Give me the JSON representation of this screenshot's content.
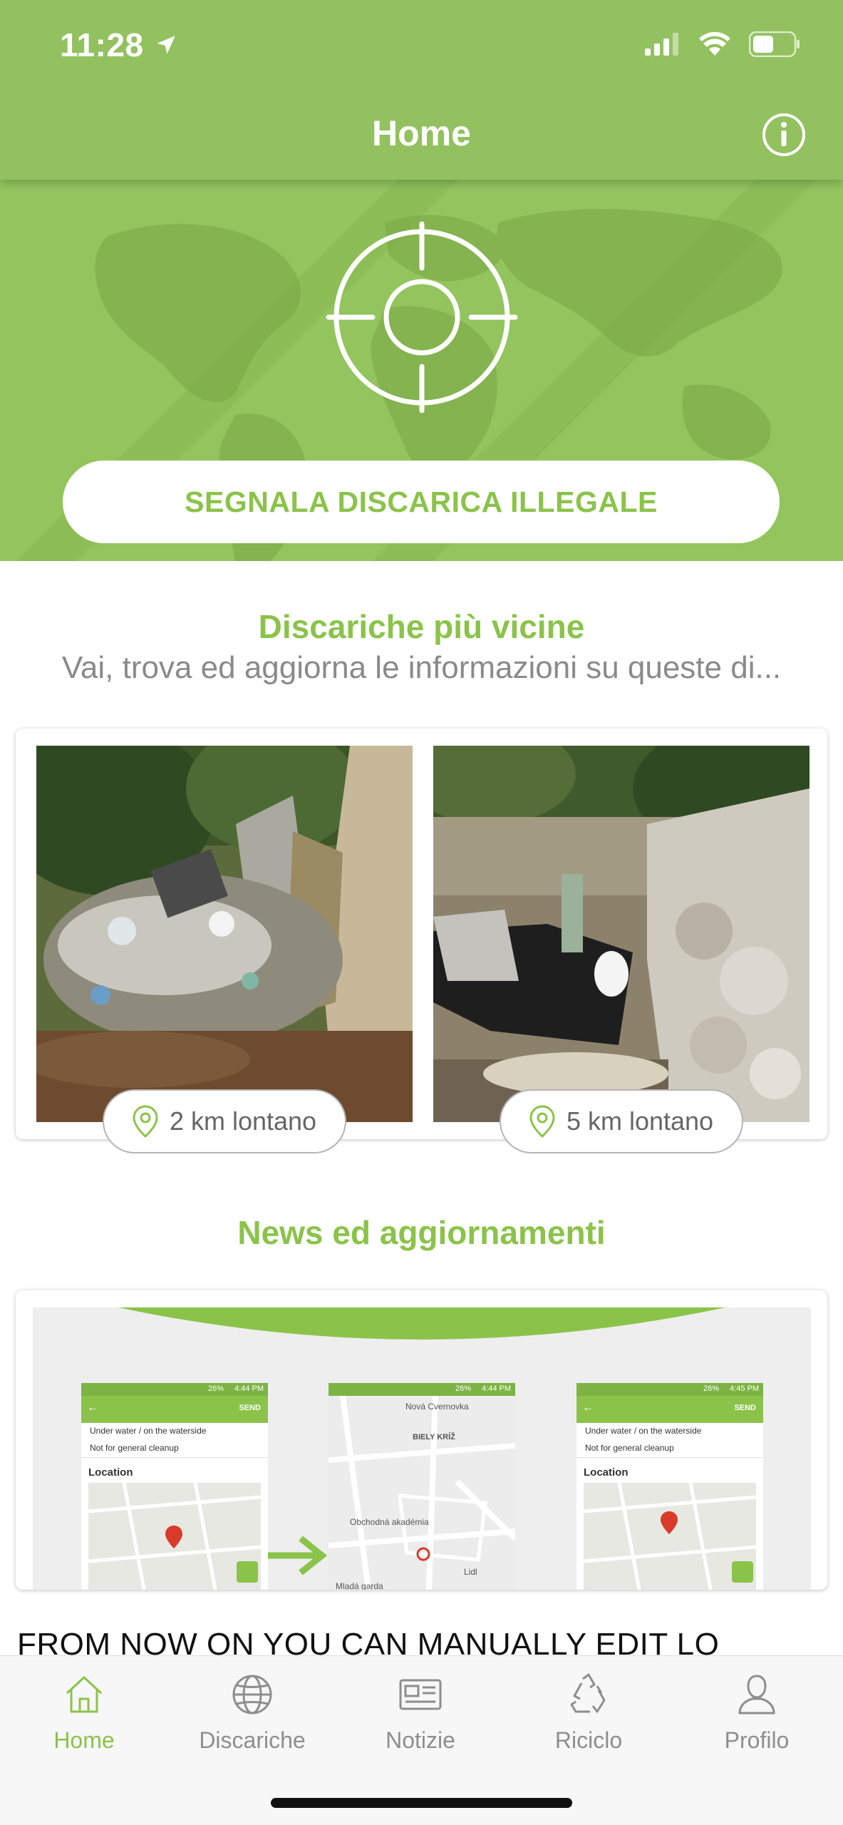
{
  "status_bar": {
    "time": "11:28"
  },
  "header": {
    "title": "Home"
  },
  "hero": {
    "report_button": "SEGNALA DISCARICA ILLEGALE"
  },
  "nearby": {
    "title": "Discariche più vicine",
    "subtitle": "Vai, trova ed aggiorna le informazioni su queste di...",
    "items": [
      {
        "distance": "2 km lontano"
      },
      {
        "distance": "5 km lontano"
      }
    ]
  },
  "news": {
    "title": "News ed aggiornamenti",
    "headline": "FROM NOW ON YOU CAN MANUALLY EDIT LO",
    "screens": [
      {
        "time": "4:44 PM",
        "battery": "26%",
        "action": "SEND",
        "row1": "Under water / on the waterside",
        "row2": "Not for general cleanup",
        "section": "Location"
      },
      {
        "time": "4:44 PM",
        "battery": "26%",
        "places": [
          "Nová Cvernovka",
          "BIELY KRÍŽ",
          "Obchodná akadémia",
          "Mladá garda",
          "Lidl"
        ]
      },
      {
        "time": "4:45 PM",
        "battery": "26%",
        "action": "SEND",
        "row1": "Under water / on the waterside",
        "row2": "Not for general cleanup",
        "section": "Location"
      }
    ]
  },
  "tabs": [
    {
      "label": "Home",
      "icon": "home-icon",
      "active": true
    },
    {
      "label": "Discariche",
      "icon": "globe-icon",
      "active": false
    },
    {
      "label": "Notizie",
      "icon": "newspaper-icon",
      "active": false
    },
    {
      "label": "Riciclo",
      "icon": "recycle-icon",
      "active": false
    },
    {
      "label": "Profilo",
      "icon": "user-icon",
      "active": false
    }
  ],
  "colors": {
    "brand": "#93c160",
    "accent": "#8bc34a",
    "muted": "#8a8a8a"
  }
}
